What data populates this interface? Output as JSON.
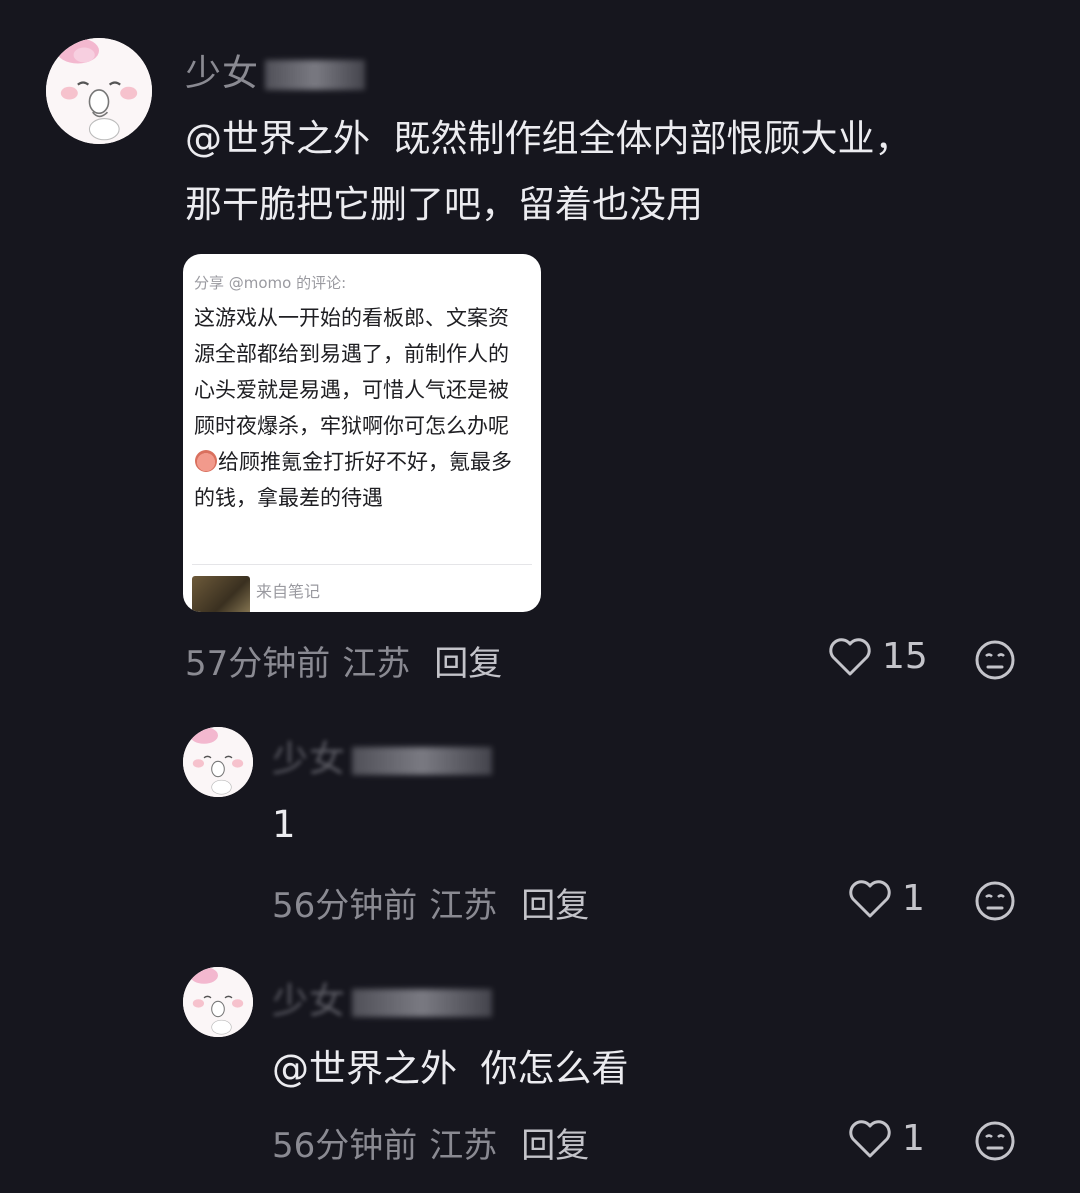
{
  "comments": [
    {
      "username": "少女",
      "mention": "@世界之外",
      "text": "既然制作组全体内部恨顾大业，",
      "text_line2": "那干脆把它删了吧，留着也没用",
      "time": "57分钟前",
      "location": "江苏",
      "reply_label": "回复",
      "likes": "15",
      "quote": {
        "header": "分享 @momo 的评论:",
        "body_part1": "这游戏从一开始的看板郎、文案资源全部都给到易遇了，前制作人的心头爱就是易遇，可惜人气还是被顾时夜爆杀，牢狱啊你可怎么办呢",
        "body_part2": "给顾推氪金打折好不好，氪最多的钱，拿最差的待遇",
        "source_label": "来自笔记"
      }
    },
    {
      "username": "少女",
      "text": "1",
      "time": "56分钟前",
      "location": "江苏",
      "reply_label": "回复",
      "likes": "1"
    },
    {
      "username": "少女",
      "mention": "@世界之外",
      "text": "你怎么看",
      "time": "56分钟前",
      "location": "江苏",
      "reply_label": "回复",
      "likes": "1"
    }
  ],
  "colors": {
    "background": "#16161e",
    "text": "#ececf0",
    "muted": "#8a8a92"
  },
  "icons": [
    "avatar-cartoon-icon",
    "heart-icon",
    "emoji-reaction-icon"
  ]
}
